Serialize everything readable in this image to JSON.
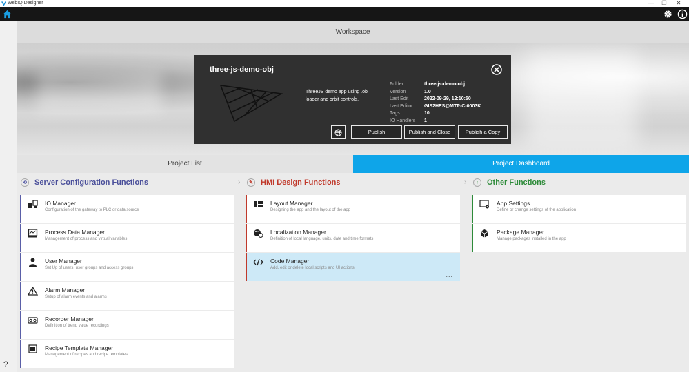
{
  "window": {
    "title": "WebIQ Designer",
    "controls": [
      "—",
      "❐",
      "✕"
    ]
  },
  "workspace": {
    "title": "Workspace"
  },
  "project": {
    "name": "three-js-demo-obj",
    "description": "ThreeJS demo app using .obj loader and orbit controls.",
    "meta": [
      {
        "key": "Folder",
        "value": "three-js-demo-obj"
      },
      {
        "key": "Version",
        "value": "1.0"
      },
      {
        "key": "Last Edit",
        "value": "2022-09-29, 12:10:50"
      },
      {
        "key": "Last Editor",
        "value": "GIS2HES@MTP-C-0003K"
      },
      {
        "key": "Tags",
        "value": "10"
      },
      {
        "key": "IO Handlers",
        "value": "1"
      }
    ],
    "buttons": {
      "publish": "Publish",
      "publish_close": "Publish and Close",
      "publish_copy": "Publish a Copy"
    }
  },
  "tabs": {
    "list": "Project List",
    "dashboard": "Project Dashboard"
  },
  "sections": {
    "server": {
      "title": "Server Configuration Functions",
      "color": "#5a5fa8",
      "items": [
        {
          "title": "IO Manager",
          "desc": "Configuration of the gateway to PLC or data source",
          "icon": "io-icon"
        },
        {
          "title": "Process Data Manager",
          "desc": "Management of process and virtual variables",
          "icon": "process-data-icon"
        },
        {
          "title": "User Manager",
          "desc": "Set Up of users, user groups and access groups",
          "icon": "user-icon"
        },
        {
          "title": "Alarm Manager",
          "desc": "Setup of alarm events and alarms",
          "icon": "alarm-icon"
        },
        {
          "title": "Recorder Manager",
          "desc": "Definition of trend value recordings",
          "icon": "recorder-icon"
        },
        {
          "title": "Recipe Template Manager",
          "desc": "Management of recipes and recipe templates",
          "icon": "recipe-icon"
        }
      ]
    },
    "hmi": {
      "title": "HMI Design Functions",
      "color": "#c0392b",
      "items": [
        {
          "title": "Layout Manager",
          "desc": "Designing the app and the layout of the app",
          "icon": "layout-icon"
        },
        {
          "title": "Localization Manager",
          "desc": "Definition of local language, units, date and time formats",
          "icon": "localization-icon"
        },
        {
          "title": "Code Manager",
          "desc": "Add, edit or delete local scripts and UI actions",
          "icon": "code-icon",
          "more": "..."
        }
      ]
    },
    "other": {
      "title": "Other Functions",
      "color": "#2e8b3a",
      "items": [
        {
          "title": "App Settings",
          "desc": "Define or change settings of the application",
          "icon": "app-settings-icon"
        },
        {
          "title": "Package Manager",
          "desc": "Manage packages installed in the app",
          "icon": "package-icon"
        }
      ]
    }
  },
  "help": "?"
}
